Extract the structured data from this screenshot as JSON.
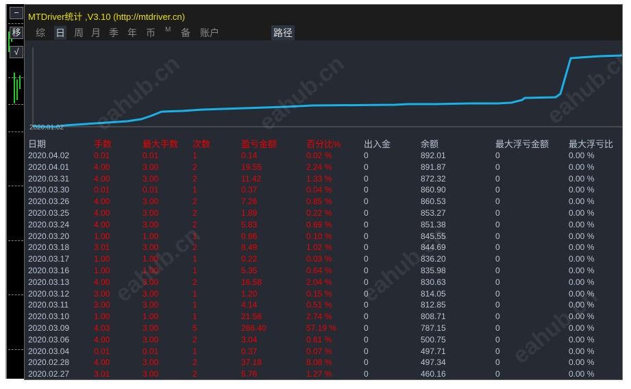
{
  "window": {
    "title": "MTDriver统计 ,V3.10 (http://mtdriver.cn)",
    "side_buttons": [
      "−",
      "移",
      "√"
    ]
  },
  "tabs": [
    {
      "label": "综"
    },
    {
      "label": "日",
      "active": true
    },
    {
      "label": "周"
    },
    {
      "label": "月"
    },
    {
      "label": "季"
    },
    {
      "label": "年"
    },
    {
      "label": "币"
    },
    {
      "label": "M"
    },
    {
      "label": "备"
    },
    {
      "label": "账户"
    }
  ],
  "path_button": "路径",
  "equity_chart": {
    "start_label": "2020.01.02",
    "line_color": "#1ab0e8"
  },
  "table": {
    "headers": [
      "日期",
      "手数",
      "最大手数",
      "次数",
      "盈亏金额",
      "百分比%",
      "出入金",
      "余额",
      "最大浮亏金额",
      "最大浮亏比"
    ],
    "rows": [
      [
        "2020.04.02",
        "0.01",
        "0.01",
        "1",
        "0.14",
        "0.02 %",
        "0",
        "892.01",
        "0",
        "0.00 %"
      ],
      [
        "2020.04.01",
        "4.00",
        "3.00",
        "2",
        "19.55",
        "2.24 %",
        "0",
        "891.87",
        "0",
        "0.00 %"
      ],
      [
        "2020.03.31",
        "4.00",
        "3.00",
        "2",
        "11.42",
        "1.33 %",
        "0",
        "872.32",
        "0",
        "0.00 %"
      ],
      [
        "2020.03.30",
        "0.01",
        "0.01",
        "1",
        "0.37",
        "0.04 %",
        "0",
        "860.90",
        "0",
        "0.00 %"
      ],
      [
        "2020.03.26",
        "4.00",
        "3.00",
        "2",
        "7.26",
        "0.85 %",
        "0",
        "860.53",
        "0",
        "0.00 %"
      ],
      [
        "2020.03.25",
        "4.00",
        "3.00",
        "2",
        "1.89",
        "0.22 %",
        "0",
        "853.27",
        "0",
        "0.00 %"
      ],
      [
        "2020.03.24",
        "4.00",
        "3.00",
        "2",
        "5.83",
        "0.69 %",
        "0",
        "851.38",
        "0",
        "0.00 %"
      ],
      [
        "2020.03.20",
        "1.00",
        "1.00",
        "1",
        "0.86",
        "0.10 %",
        "0",
        "845.55",
        "0",
        "0.00 %"
      ],
      [
        "2020.03.18",
        "3.01",
        "3.00",
        "2",
        "8.49",
        "1.02 %",
        "0",
        "844.69",
        "0",
        "0.00 %"
      ],
      [
        "2020.03.17",
        "1.00",
        "1.00",
        "1",
        "0.22",
        "0.03 %",
        "0",
        "836.20",
        "0",
        "0.00 %"
      ],
      [
        "2020.03.16",
        "1.00",
        "1.00",
        "1",
        "5.35",
        "0.64 %",
        "0",
        "835.98",
        "0",
        "0.00 %"
      ],
      [
        "2020.03.13",
        "4.00",
        "3.00",
        "2",
        "16.58",
        "2.04 %",
        "0",
        "830.63",
        "0",
        "0.00 %"
      ],
      [
        "2020.03.12",
        "3.00",
        "3.00",
        "1",
        "1.20",
        "0.15 %",
        "0",
        "814.05",
        "0",
        "0.00 %"
      ],
      [
        "2020.03.11",
        "3.00",
        "3.00",
        "1",
        "4.14",
        "0.51 %",
        "0",
        "812.85",
        "0",
        "0.00 %"
      ],
      [
        "2020.03.10",
        "1.00",
        "1.00",
        "1",
        "21.56",
        "2.74 %",
        "0",
        "808.71",
        "0",
        "0.00 %"
      ],
      [
        "2020.03.09",
        "4.03",
        "3.00",
        "5",
        "286.40",
        "57.19 %",
        "0",
        "787.15",
        "0",
        "0.00 %"
      ],
      [
        "2020.03.06",
        "4.00",
        "3.00",
        "2",
        "3.04",
        "0.61 %",
        "0",
        "500.75",
        "0",
        "0.00 %"
      ],
      [
        "2020.03.04",
        "0.01",
        "0.01",
        "1",
        "0.37",
        "0.07 %",
        "0",
        "497.71",
        "0",
        "0.00 %"
      ],
      [
        "2020.02.28",
        "4.00",
        "3.00",
        "2",
        "37.18",
        "8.08 %",
        "0",
        "497.34",
        "0",
        "0.00 %"
      ],
      [
        "2020.02.27",
        "3.01",
        "3.00",
        "2",
        "5.76",
        "1.27 %",
        "0",
        "460.16",
        "0",
        "0.00 %"
      ]
    ]
  },
  "watermark": "eahub.cn"
}
